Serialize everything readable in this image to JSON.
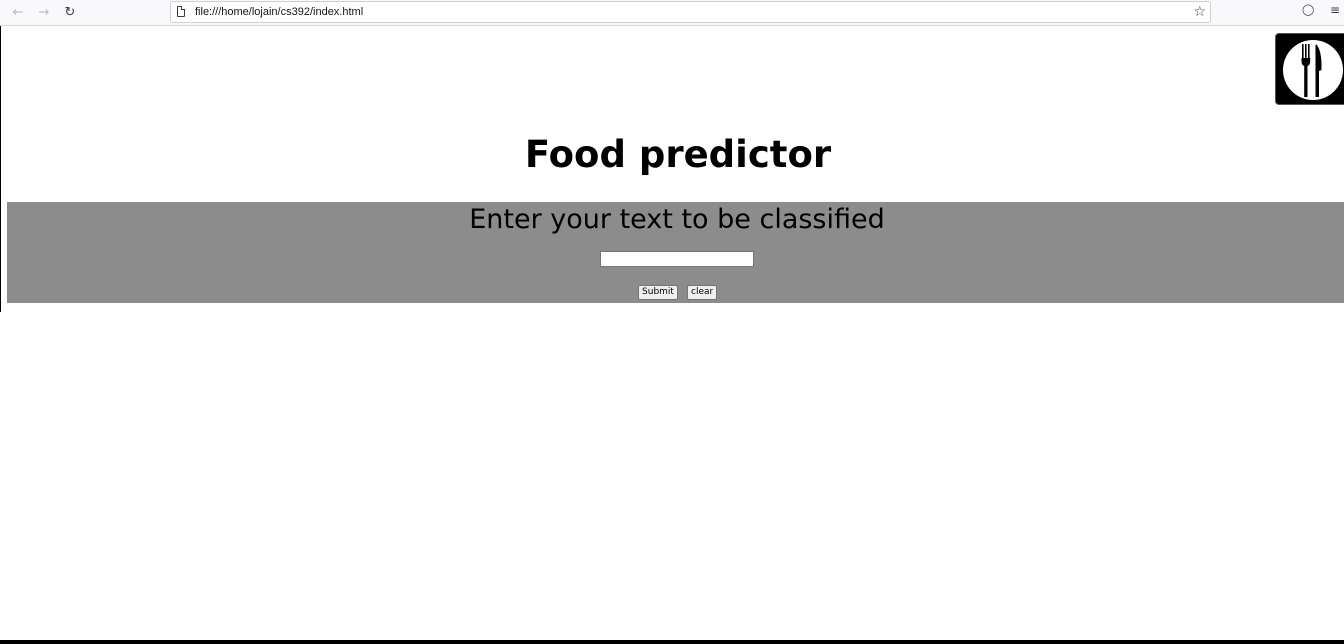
{
  "browser": {
    "back_icon": "arrow-left-icon",
    "forward_icon": "arrow-right-icon",
    "reload_icon": "reload-icon",
    "url": "file:///home/lojain/cs392/index.html",
    "bookmark_icon": "star-icon",
    "pocket_icon": "pocket-icon",
    "menu_icon": "hamburger-menu-icon"
  },
  "page": {
    "logo_icon": "fork-knife-plate-icon",
    "title": "Food predictor",
    "form": {
      "heading": "Enter your text to be classified",
      "input_value": "",
      "submit_label": "Submit",
      "clear_label": "clear"
    }
  },
  "colors": {
    "panel_background": "#8c8c8c",
    "page_background": "#ffffff",
    "logo_background": "#000000"
  }
}
